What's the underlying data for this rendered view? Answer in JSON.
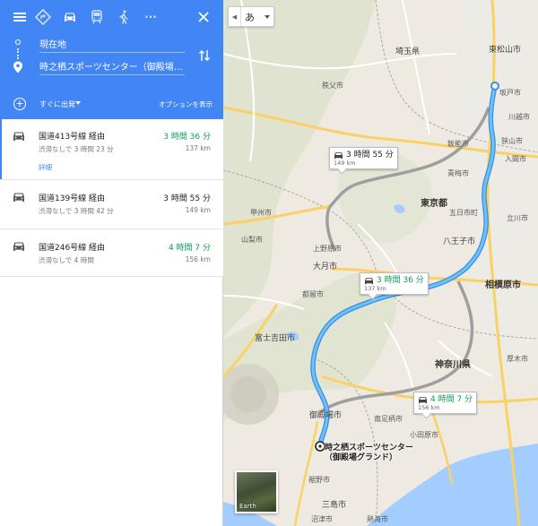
{
  "header": {
    "modes": [
      {
        "name": "menu-icon"
      },
      {
        "name": "best-route-icon"
      },
      {
        "name": "car-icon"
      },
      {
        "name": "transit-icon"
      },
      {
        "name": "walk-icon"
      },
      {
        "name": "more-icon",
        "label": "···"
      }
    ],
    "origin": "現在地",
    "destination": "時之栖スポーツセンター（御殿場グランド）, 〒",
    "depart": "すぐに出発",
    "options": "オプションを表示",
    "accent_color": "#4285f4"
  },
  "routes": [
    {
      "name": "国道413号線 経由",
      "time": "3 時間 36 分",
      "time_color": "#0f9d58",
      "traffic": "渋滞なしで 3 時間 23 分",
      "distance": "137 km",
      "details": "詳細"
    },
    {
      "name": "国道139号線 経由",
      "time": "3 時間 55 分",
      "time_color": "#222222",
      "traffic": "渋滞なしで 3 時間 42 分",
      "distance": "149 km"
    },
    {
      "name": "国道246号線 経由",
      "time": "4 時間 7 分",
      "time_color": "#0f9d58",
      "traffic": "渋滞なしで 4 時間",
      "distance": "156 km"
    }
  ],
  "map": {
    "ime_char": "あ",
    "earth": "Earth",
    "route_color": "#4aa8f0",
    "callouts": [
      {
        "time": "3 時間 55 分",
        "distance": "149 km"
      },
      {
        "time": "3 時間 36 分",
        "distance": "137 km"
      },
      {
        "time": "4 時間 7 分",
        "distance": "156 km"
      }
    ],
    "destination_label_1": "時之栖スポーツセンター",
    "destination_label_2": "（御殿場グランド）",
    "labels": {
      "saitama": "埼玉県",
      "higashimatsuyama": "東松山市",
      "sakado": "坂戸市",
      "kawagoe": "川越市",
      "iruma": "入間市",
      "sayama": "狭山市",
      "hanno": "飯能市",
      "chichibu": "秩父市",
      "oume": "青梅市",
      "tokyo": "東京都",
      "hachioji": "八王子市",
      "tachikawa": "立川市",
      "itsukaichi": "五日市町",
      "sagamihara": "相模原市",
      "otsuki": "大月市",
      "tsuru": "都留市",
      "fujiyoshida": "富士吉田市",
      "kanagawa": "神奈川県",
      "atsugi": "厚木市",
      "odawara": "小田原市",
      "minamiashigara": "南足柄市",
      "gotemba": "御殿場市",
      "susono": "裾野市",
      "mishima": "三島市",
      "numazu": "沼津市",
      "atami": "熱海市",
      "koshu": "甲州市",
      "uenohara": "上野原市",
      "yamanashi": "山梨市"
    }
  }
}
